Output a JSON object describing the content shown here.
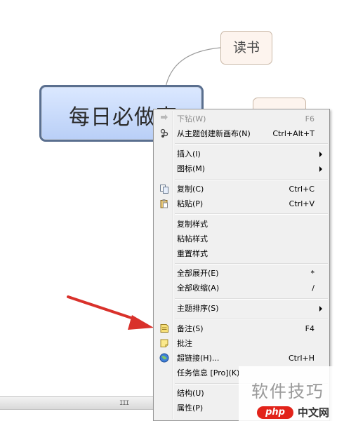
{
  "mindmap": {
    "central_topic": "每日必做事",
    "subtopic_reading": "读书",
    "subtopic_hidden": ""
  },
  "scrollbar": {
    "grip": "III"
  },
  "context_menu": {
    "items": [
      {
        "label": "下钻(W)",
        "shortcut": "F6",
        "icon": "drill-down-icon",
        "disabled": true
      },
      {
        "label": "从主题创建新画布(N)",
        "shortcut": "Ctrl+Alt+T",
        "icon": "new-sheet-icon"
      },
      {
        "label": "插入(I)",
        "submenu": true
      },
      {
        "label": "图标(M)",
        "submenu": true
      },
      {
        "label": "复制(C)",
        "shortcut": "Ctrl+C",
        "icon": "copy-icon"
      },
      {
        "label": "粘贴(P)",
        "shortcut": "Ctrl+V",
        "icon": "paste-icon"
      },
      {
        "label": "复制样式"
      },
      {
        "label": "粘帖样式"
      },
      {
        "label": "重置样式"
      },
      {
        "label": "全部展开(E)",
        "shortcut": "*"
      },
      {
        "label": "全部收缩(A)",
        "shortcut": "/"
      },
      {
        "label": "主题排序(S)",
        "submenu": true
      },
      {
        "label": "备注(S)",
        "shortcut": "F4",
        "icon": "notes-icon"
      },
      {
        "label": "批注",
        "icon": "comment-icon"
      },
      {
        "label": "超链接(H)...",
        "shortcut": "Ctrl+H",
        "icon": "hyperlink-globe-icon"
      },
      {
        "label": "任务信息 [Pro](K)"
      },
      {
        "label": "结构(U)",
        "submenu": true
      },
      {
        "label": "属性(P)"
      }
    ]
  },
  "annotation": {
    "arrow_color": "#d9312b"
  },
  "watermark": {
    "text": "软件技巧",
    "php": "php",
    "cn": "中文网"
  }
}
